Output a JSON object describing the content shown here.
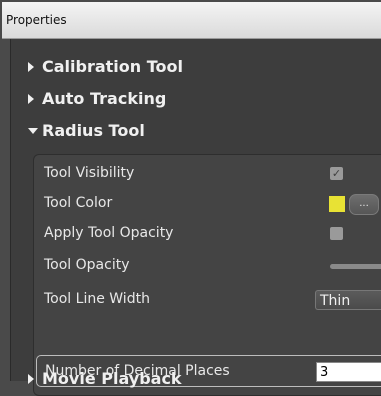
{
  "window": {
    "title": "Properties"
  },
  "sections": {
    "calibration": {
      "label": "Calibration Tool",
      "expanded": false
    },
    "auto_tracking": {
      "label": "Auto Tracking",
      "expanded": false
    },
    "radius_tool": {
      "label": "Radius Tool",
      "expanded": true
    },
    "movie_playback": {
      "label": "Movie Playback",
      "expanded": false
    }
  },
  "radius_tool_props": {
    "tool_visibility": {
      "label": "Tool Visibility",
      "checked": true,
      "check_glyph": "✓"
    },
    "tool_color": {
      "label": "Tool Color",
      "color": "#e8e234",
      "button_label": "..."
    },
    "apply_tool_opacity": {
      "label": "Apply Tool Opacity",
      "checked": false
    },
    "tool_opacity": {
      "label": "Tool Opacity"
    },
    "tool_line_width": {
      "label": "Tool Line Width",
      "value": "Thin"
    },
    "decimal_places": {
      "label": "Number of Decimal Places",
      "value": "3"
    }
  },
  "colors": {
    "background": "#4a4a4a",
    "panel": "#3d3d3d",
    "accent_swatch": "#e8e234"
  }
}
